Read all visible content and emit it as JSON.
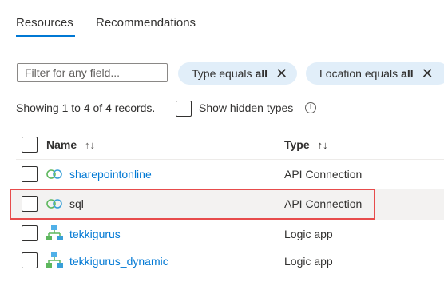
{
  "tabs": [
    {
      "label": "Resources",
      "active": true
    },
    {
      "label": "Recommendations",
      "active": false
    }
  ],
  "filter": {
    "placeholder": "Filter for any field..."
  },
  "pills": [
    {
      "label": "Type equals",
      "value": "all"
    },
    {
      "label": "Location equals",
      "value": "all"
    }
  ],
  "summary": "Showing 1 to 4 of 4 records.",
  "show_hidden_label": "Show hidden types",
  "columns": {
    "name": "Name",
    "type": "Type",
    "sort_both": "↑↓"
  },
  "rows": [
    {
      "name": "sharepointonline",
      "type": "API Connection",
      "icon": "api-connection-icon"
    },
    {
      "name": "sql",
      "type": "API Connection",
      "icon": "api-connection-icon"
    },
    {
      "name": "tekkigurus",
      "type": "Logic app",
      "icon": "logic-app-icon"
    },
    {
      "name": "tekkigurus_dynamic",
      "type": "Logic app",
      "icon": "logic-app-icon"
    }
  ],
  "colors": {
    "accent": "#0078d4",
    "pill_bg": "#e1eef9",
    "highlight_border": "#e74c4c"
  }
}
